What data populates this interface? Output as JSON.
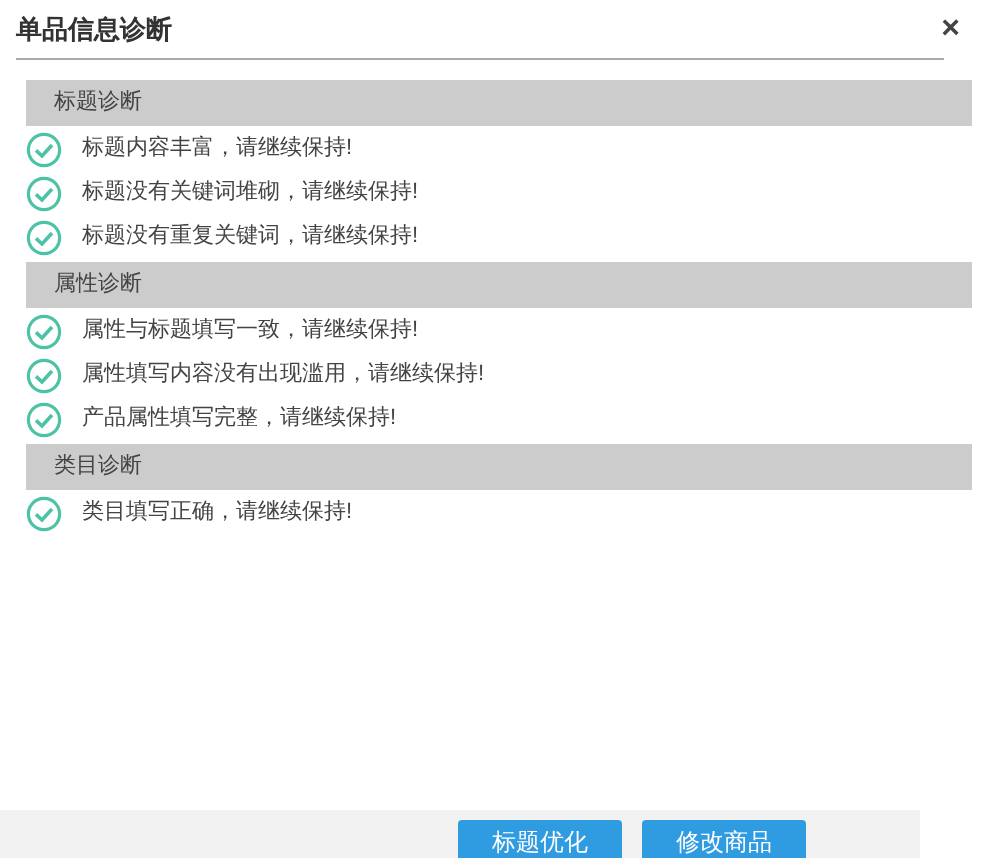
{
  "window": {
    "title": "单品信息诊断",
    "close": "×"
  },
  "sections": [
    {
      "title": "标题诊断",
      "items": [
        {
          "text": "标题内容丰富，请继续保持!",
          "passed": true
        },
        {
          "text": "标题没有关键词堆砌，请继续保持!",
          "passed": true
        },
        {
          "text": "标题没有重复关键词，请继续保持!",
          "passed": true
        }
      ]
    },
    {
      "title": "属性诊断",
      "items": [
        {
          "text": "属性与标题填写一致，请继续保持!",
          "passed": true
        },
        {
          "text": "属性填写内容没有出现滥用，请继续保持!",
          "passed": true
        },
        {
          "text": "产品属性填写完整，请继续保持!",
          "passed": true
        }
      ]
    },
    {
      "title": "类目诊断",
      "items": [
        {
          "text": "类目填写正确，请继续保持!",
          "passed": true
        }
      ]
    }
  ],
  "buttons": [
    "标题优化",
    "修改商品"
  ]
}
